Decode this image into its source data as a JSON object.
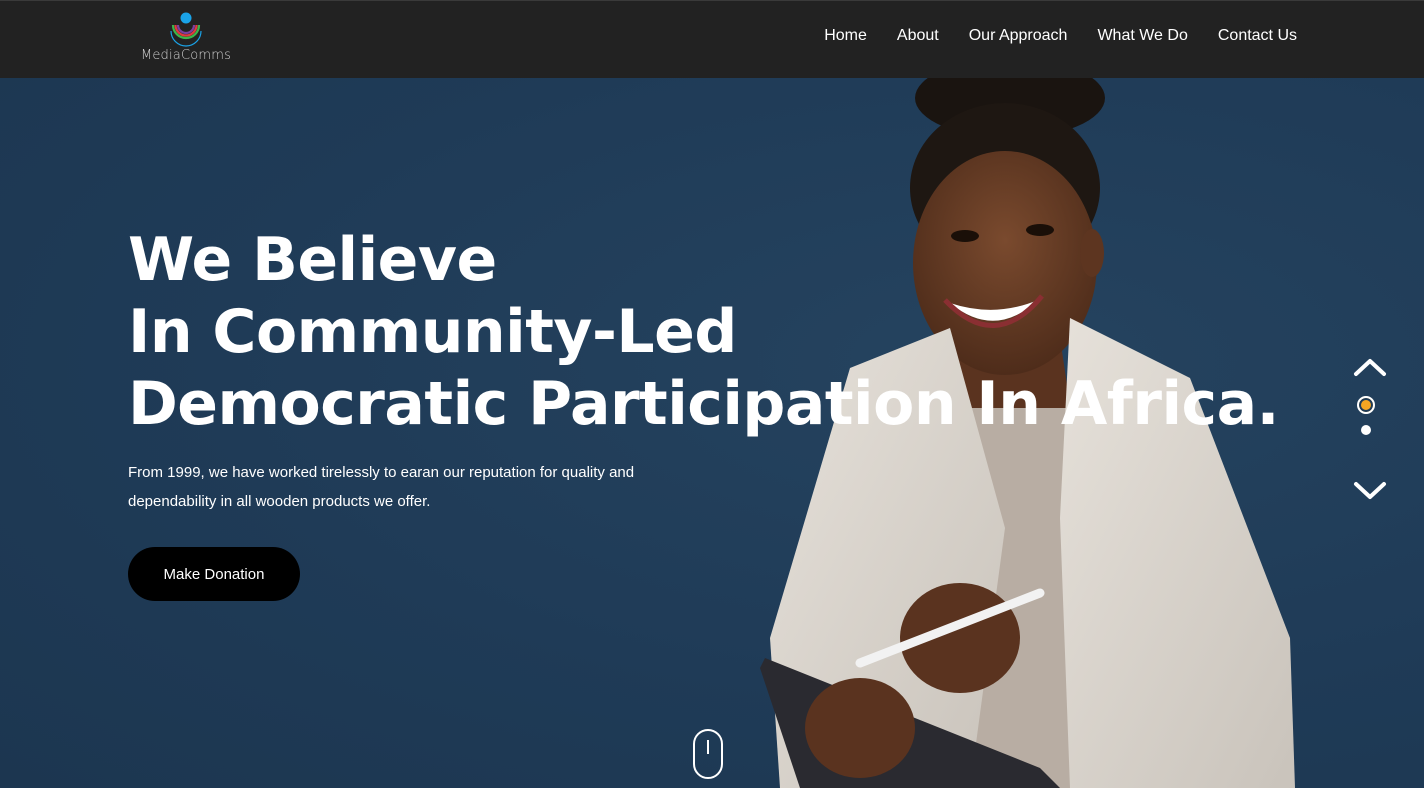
{
  "brand": {
    "name": "MediaComms"
  },
  "nav": {
    "items": [
      {
        "label": "Home"
      },
      {
        "label": "About"
      },
      {
        "label": "Our Approach"
      },
      {
        "label": "What We Do"
      },
      {
        "label": "Contact Us"
      }
    ]
  },
  "hero": {
    "headline_lines": [
      "We Believe",
      "In Community-Led",
      "Democratic Participation In Africa."
    ],
    "subtext": "From 1999, we have worked tirelessly to earan our reputation for quality and dependability in all wooden products we offer.",
    "cta_label": "Make Donation",
    "slider": {
      "active_index": 1,
      "total": 2
    }
  },
  "icons": {
    "slider_up": "chevron-up-icon",
    "slider_down": "chevron-down-icon",
    "scroll": "mouse-scroll-icon"
  },
  "colors": {
    "nav_bg": "#222222",
    "hero_bg": "#1f3b57",
    "accent": "#f5a623",
    "button_bg": "#000000",
    "logo_blue": "#1aa3e8",
    "logo_ring_green": "#3bb54a",
    "logo_ring_red": "#e03a3e",
    "logo_ring_purple": "#7b3fa0"
  }
}
